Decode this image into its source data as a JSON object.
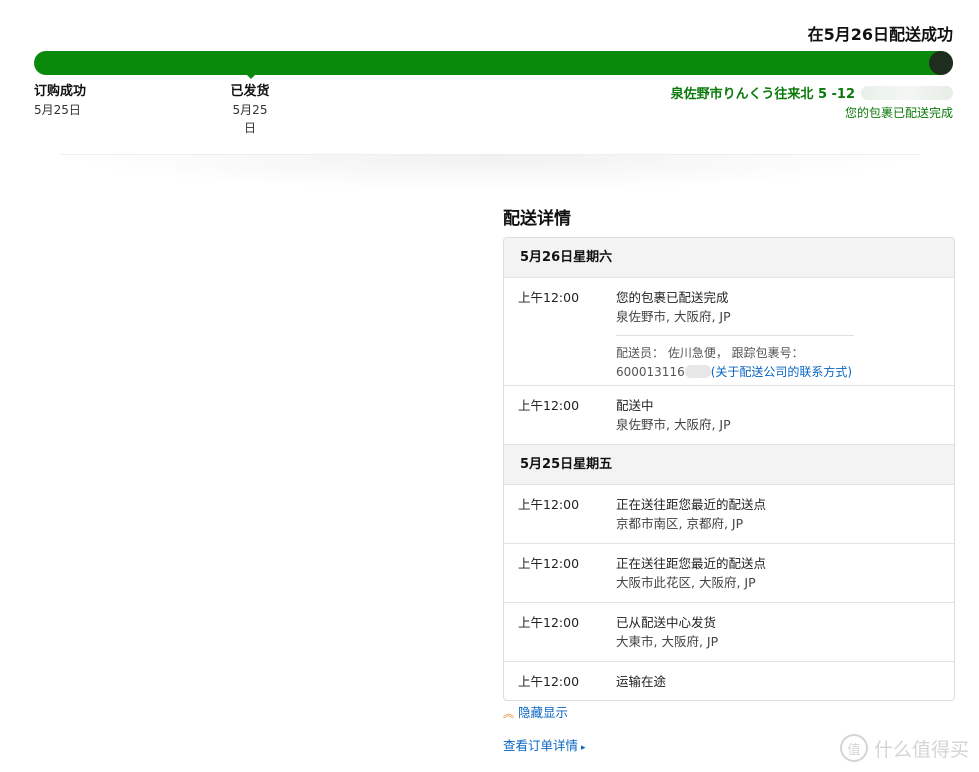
{
  "status": {
    "title": "在5月26日配送成功",
    "progress": 1.0,
    "colors": {
      "progress": "#0a8a0a",
      "end_marker": "#1f2d1f",
      "link": "#0a66c2"
    }
  },
  "milestones": {
    "ordered": {
      "label": "订购成功",
      "date": "5月25日"
    },
    "shipped": {
      "label": "已发货",
      "date": "5月25日"
    },
    "destination": {
      "address": "泉佐野市りんくう往来北 5 -12",
      "status": "您的包裹已配送完成"
    }
  },
  "details": {
    "heading": "配送详情",
    "days": [
      {
        "date": "5月26日星期六",
        "events": [
          {
            "time": "上午12:00",
            "status": "您的包裹已配送完成",
            "location": "泉佐野市, 大阪府, JP",
            "carrier_label": "配送员： 佐川急便， 跟踪包裹号：",
            "tracking_prefix": "600013116",
            "contact_link": "(关于配送公司的联系方式)"
          },
          {
            "time": "上午12:00",
            "status": "配送中",
            "location": "泉佐野市, 大阪府, JP"
          }
        ]
      },
      {
        "date": "5月25日星期五",
        "events": [
          {
            "time": "上午12:00",
            "status": "正在送往距您最近的配送点",
            "location": "京都市南区, 京都府, JP"
          },
          {
            "time": "上午12:00",
            "status": "正在送往距您最近的配送点",
            "location": "大阪市此花区, 大阪府, JP"
          },
          {
            "time": "上午12:00",
            "status": "已从配送中心发货",
            "location": "大東市, 大阪府, JP"
          },
          {
            "time": "上午12:00",
            "status": "运输在途"
          }
        ]
      }
    ]
  },
  "actions": {
    "collapse": "隐藏显示",
    "order_details": "查看订单详情"
  },
  "icons": {
    "collapse": "double-chevron-up-icon",
    "order_arrow": "triangle-right-icon"
  },
  "watermark": {
    "badge": "值",
    "text": "什么值得买"
  }
}
